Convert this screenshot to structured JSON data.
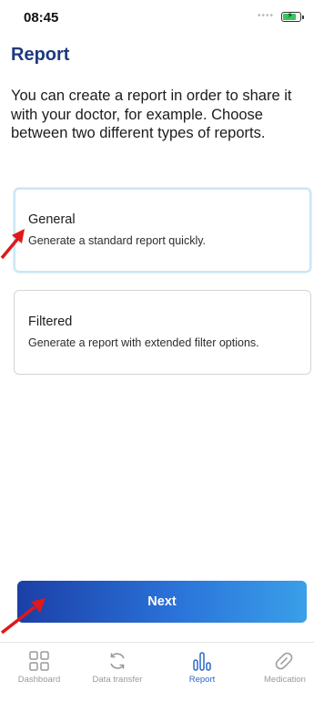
{
  "status_bar": {
    "time": "08:45"
  },
  "page": {
    "title": "Report",
    "intro": "You can create a report in order to share it with your doctor, for example. Choose between two different types of reports."
  },
  "options": [
    {
      "title": "General",
      "description": "Generate a standard report quickly.",
      "selected": true
    },
    {
      "title": "Filtered",
      "description": "Generate a report with extended filter options.",
      "selected": false
    }
  ],
  "actions": {
    "next_label": "Next"
  },
  "tabs": [
    {
      "label": "Dashboard",
      "icon": "dashboard-icon",
      "active": false
    },
    {
      "label": "Data transfer",
      "icon": "sync-icon",
      "active": false
    },
    {
      "label": "Report",
      "icon": "report-chart-icon",
      "active": true
    },
    {
      "label": "Medication",
      "icon": "pill-icon",
      "active": false
    }
  ],
  "colors": {
    "title": "#1d3a80",
    "button_start": "#1b3fa6",
    "button_end": "#3a9fe8",
    "selected_border": "#c9e6f6",
    "active_tab": "#2a68c8",
    "inactive_tab": "#9a9a9a",
    "annotation_arrow": "#e01818"
  }
}
